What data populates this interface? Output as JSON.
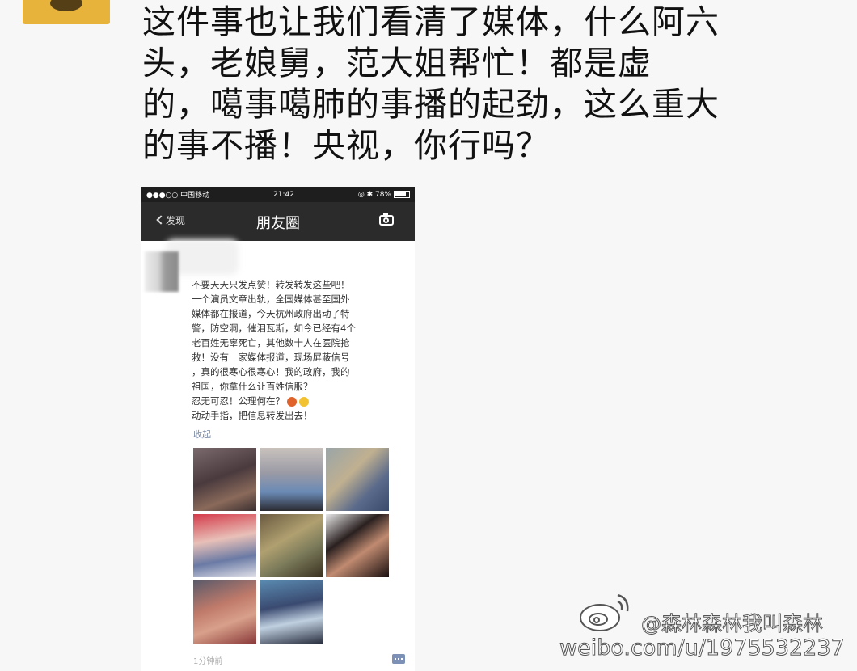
{
  "post": {
    "lines": [
      "这件事也让我们看清了媒体，什么阿六",
      "头，老娘舅，范大姐帮忙！都是虚",
      "的，噶事噶肺的事播的起劲，这么重大",
      "的事不播！央视，你行吗？"
    ]
  },
  "phone": {
    "status": {
      "carrier": "●●●○○ 中国移动 ",
      "time": "21:42",
      "battery": "◎ ✱ 78%"
    },
    "nav": {
      "back": "发现",
      "title": "朋友圈"
    },
    "moment": {
      "lines": [
        "不要天天只发点赞！转发转发这些吧！",
        "一个演员文章出轨，全国媒体甚至国外",
        "媒体都在报道，今天杭州政府出动了特",
        "警，防空洞，催泪瓦斯，如今已经有4个",
        "老百姓无辜死亡，其他数十人在医院抢",
        "救！没有一家媒体报道，现场屏蔽信号",
        "，真的很寒心很寒心！我的政府，我的",
        "祖国，你拿什么让百姓信服？",
        "忍无可忍！公理何在？",
        "动动手指，把信息转发出去！"
      ],
      "collapse": "收起",
      "time": "1分钟前",
      "emoji_colors": [
        "#e0632b",
        "#f2c230"
      ]
    }
  },
  "watermark": {
    "handle": "@森林森林我叫森林",
    "url": "weibo.com/u/1975532237"
  },
  "colors": {
    "status_bar": "#1e1e1e",
    "nav_bar": "#2b2b2b",
    "link": "#7a8aa6",
    "avatar": "#e8b33a"
  }
}
